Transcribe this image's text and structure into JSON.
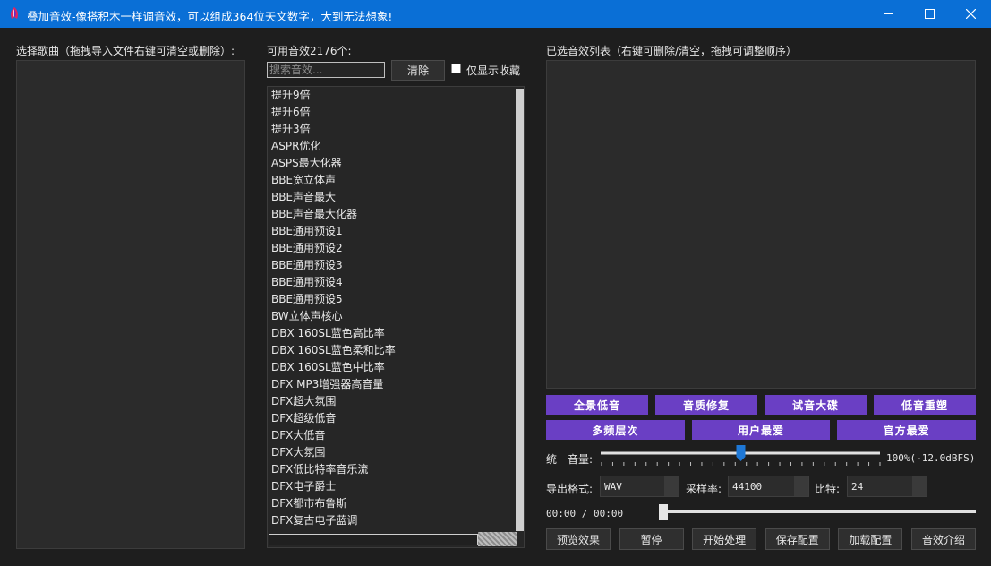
{
  "window": {
    "title": "叠加音效-像搭积木一样调音效，可以组成364位天文数字，大到无法想象!",
    "icons": {
      "minimize": "minimize-icon",
      "maximize": "maximize-icon",
      "close": "close-icon",
      "app": "app-logo-icon"
    }
  },
  "left": {
    "label": "选择歌曲（拖拽导入文件右键可清空或删除）:"
  },
  "middle": {
    "count_label": "可用音效2176个:",
    "search_placeholder": "搜索音效...",
    "clear_label": "清除",
    "favorites_label": "仅显示收藏",
    "favorites_checked": false,
    "effects": [
      "提升9倍",
      "提升6倍",
      "提升3倍",
      "ASPR优化",
      "ASPS最大化器",
      "BBE宽立体声",
      "BBE声音最大",
      "BBE声音最大化器",
      "BBE通用预设1",
      "BBE通用预设2",
      "BBE通用预设3",
      "BBE通用预设4",
      "BBE通用预设5",
      "BW立体声核心",
      "DBX 160SL蓝色高比率",
      "DBX 160SL蓝色柔和比率",
      "DBX 160SL蓝色中比率",
      "DFX MP3增强器高音量",
      "DFX超大氛围",
      "DFX超级低音",
      "DFX大低音",
      "DFX大氛围",
      "DFX低比特率音乐流",
      "DFX电子爵士",
      "DFX都市布鲁斯",
      "DFX复古电子蓝调"
    ]
  },
  "right": {
    "label": "已选音效列表（右键可删除/清空，拖拽可调整顺序）",
    "preset_row1": [
      "全景低音",
      "音质修复",
      "试音大碟",
      "低音重塑"
    ],
    "preset_row2": [
      "多频层次",
      "用户最爱",
      "官方最爱"
    ],
    "volume_label": "统一音量:",
    "volume_value": "100%(-12.0dBFS)",
    "volume_level": 0.5,
    "format_label": "导出格式:",
    "format_value": "WAV",
    "rate_label": "采样率:",
    "rate_value": "44100",
    "bit_label": "比特:",
    "bit_value": "24",
    "time_display": "00:00 / 00:00",
    "playback_progress": 0,
    "actions": [
      "预览效果",
      "暂停",
      "开始处理",
      "保存配置",
      "加载配置",
      "音效介绍"
    ]
  },
  "colors": {
    "titlebar": "#0a6fd6",
    "accent": "#6a3fc4",
    "background": "#1e1e1e"
  }
}
